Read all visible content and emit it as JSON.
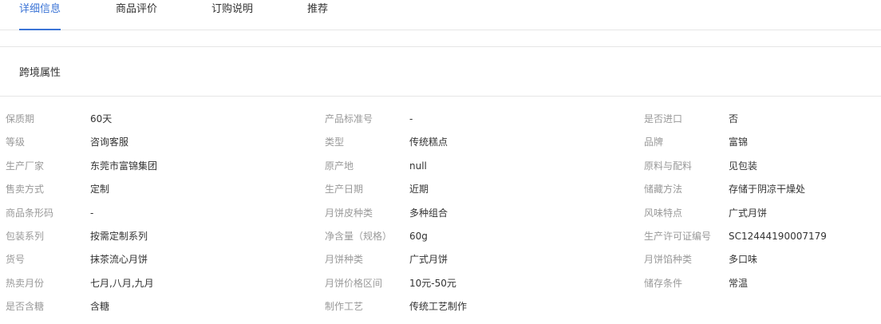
{
  "tabs": [
    {
      "label": "详细信息",
      "active": true
    },
    {
      "label": "商品评价",
      "active": false
    },
    {
      "label": "订购说明",
      "active": false
    },
    {
      "label": "推荐",
      "active": false
    }
  ],
  "section_title": "跨境属性",
  "attributes": [
    [
      {
        "k": "保质期",
        "v": "60天"
      },
      {
        "k": "产品标准号",
        "v": "-"
      },
      {
        "k": "是否进口",
        "v": "否"
      }
    ],
    [
      {
        "k": "等级",
        "v": "咨询客服"
      },
      {
        "k": "类型",
        "v": "传统糕点"
      },
      {
        "k": "品牌",
        "v": "富锦"
      }
    ],
    [
      {
        "k": "生产厂家",
        "v": "东莞市富锦集团"
      },
      {
        "k": "原产地",
        "v": "null"
      },
      {
        "k": "原料与配料",
        "v": "见包装"
      }
    ],
    [
      {
        "k": "售卖方式",
        "v": "定制"
      },
      {
        "k": "生产日期",
        "v": "近期"
      },
      {
        "k": "储藏方法",
        "v": "存储于阴凉干燥处"
      }
    ],
    [
      {
        "k": "商品条形码",
        "v": "-"
      },
      {
        "k": "月饼皮种类",
        "v": "多种组合"
      },
      {
        "k": "风味特点",
        "v": "广式月饼"
      }
    ],
    [
      {
        "k": "包装系列",
        "v": "按需定制系列"
      },
      {
        "k": "净含量（规格）",
        "v": "60g"
      },
      {
        "k": "生产许可证编号",
        "v": "SC12444190007179"
      }
    ],
    [
      {
        "k": "货号",
        "v": "抹茶流心月饼"
      },
      {
        "k": "月饼种类",
        "v": "广式月饼"
      },
      {
        "k": "月饼馅种类",
        "v": "多口味"
      }
    ],
    [
      {
        "k": "热卖月份",
        "v": "七月,八月,九月"
      },
      {
        "k": "月饼价格区间",
        "v": "10元-50元"
      },
      {
        "k": "储存条件",
        "v": "常温"
      }
    ],
    [
      {
        "k": "是否含糖",
        "v": "含糖"
      },
      {
        "k": "制作工艺",
        "v": "传统工艺制作"
      }
    ]
  ]
}
